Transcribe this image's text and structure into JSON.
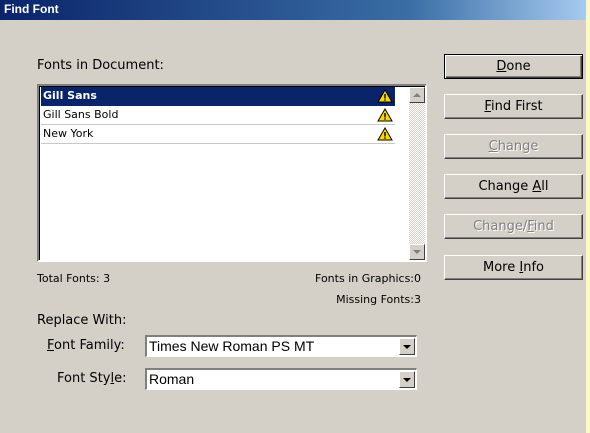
{
  "window": {
    "title": "Find Font"
  },
  "fonts_section": {
    "label": "Fonts in Document:"
  },
  "fonts": [
    {
      "name": "Gill Sans",
      "selected": true,
      "status_icon": "warning-icon"
    },
    {
      "name": "Gill Sans Bold",
      "selected": false,
      "status_icon": "warning-icon"
    },
    {
      "name": "New York",
      "selected": false,
      "status_icon": "warning-icon"
    }
  ],
  "stats": {
    "total_fonts": "Total Fonts: 3",
    "fonts_in_graphics": "Fonts in Graphics:0",
    "missing_fonts": "Missing Fonts:3"
  },
  "replace": {
    "label": "Replace With:",
    "font_family_label_pre": "",
    "font_family_label_mn": "F",
    "font_family_label_post": "ont Family:",
    "font_family_value": "Times New Roman PS MT",
    "font_style_label_pre": "Font Sty",
    "font_style_label_mn": "l",
    "font_style_label_post": "e:",
    "font_style_value": "Roman"
  },
  "buttons": {
    "done": {
      "pre": "",
      "mn": "D",
      "post": "one",
      "enabled": true
    },
    "find_first": {
      "pre": "",
      "mn": "F",
      "post": "ind First",
      "enabled": true
    },
    "change": {
      "pre": "",
      "mn": "C",
      "post": "hange",
      "enabled": false
    },
    "change_all": {
      "pre": "Change ",
      "mn": "A",
      "post": "ll",
      "enabled": true
    },
    "change_find": {
      "pre": "Change/",
      "mn": "F",
      "post": "ind",
      "enabled": false
    },
    "more_info": {
      "pre": "More ",
      "mn": "I",
      "post": "nfo",
      "enabled": true
    }
  },
  "colors": {
    "selection": "#0a246a",
    "title_gradient_start": "#0a246a",
    "dialog_face": "#d4d0c8",
    "warning_fill": "#ffd700"
  }
}
